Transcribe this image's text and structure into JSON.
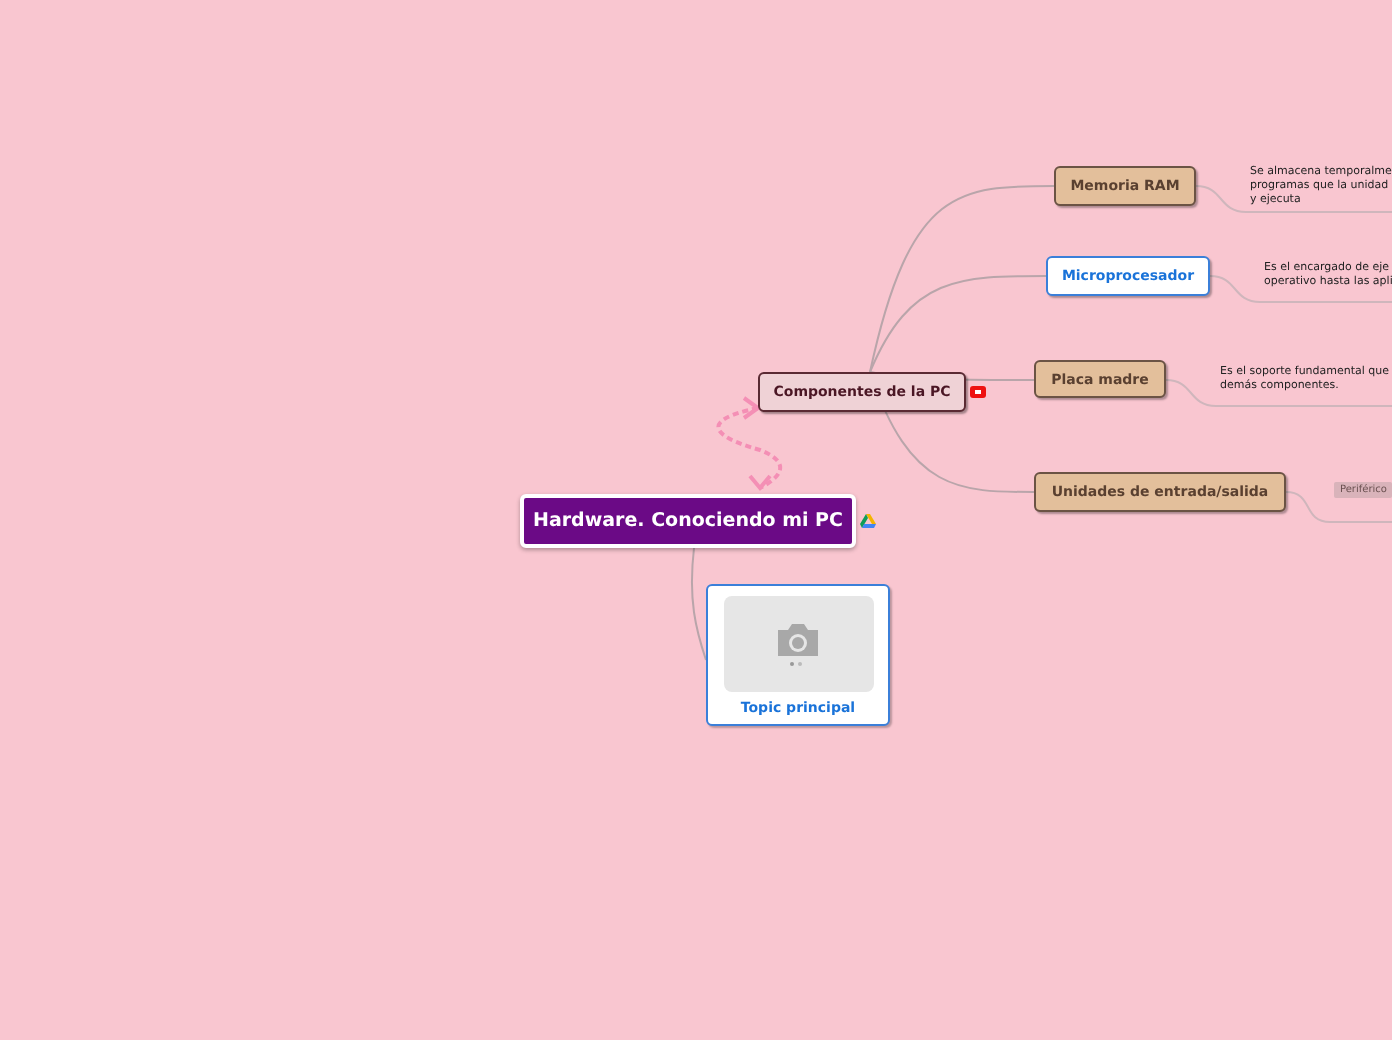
{
  "central_topic": {
    "label": "Hardware. Conociendo mi PC"
  },
  "main_topic": {
    "label": "Componentes de la PC"
  },
  "subtopics": [
    {
      "label": "Memoria RAM",
      "kind": "tan",
      "note": {
        "kind": "text",
        "lines": [
          "Se almacena temporalme",
          "programas que la unidad",
          "y ejecuta"
        ]
      }
    },
    {
      "label": "Microprocesador",
      "kind": "blue",
      "note": {
        "kind": "text",
        "lines": [
          "Es el encargado de eje",
          "operativo hasta las apli"
        ]
      }
    },
    {
      "label": "Placa madre",
      "kind": "tan",
      "note": {
        "kind": "text",
        "lines": [
          "Es el soporte fundamental que",
          "demás componentes."
        ]
      }
    },
    {
      "label": "Unidades de entrada/salida",
      "kind": "tan",
      "note": {
        "kind": "tag",
        "lines": [
          "Periférico"
        ]
      }
    }
  ],
  "image_topic": {
    "label": "Topic principal"
  }
}
